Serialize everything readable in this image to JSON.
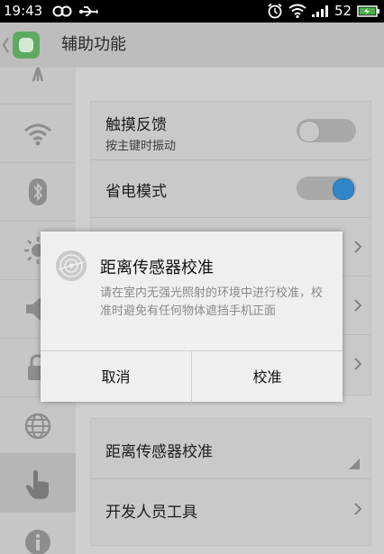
{
  "status_bar": {
    "time": "19:43",
    "battery": "52"
  },
  "header": {
    "title": "辅助功能"
  },
  "settings": {
    "touch_feedback": {
      "label": "触摸反馈",
      "sub": "按主键时振动",
      "state": "off"
    },
    "power_saving": {
      "label": "省电模式",
      "state": "on"
    },
    "proximity_calibration": {
      "label": "距离传感器校准"
    },
    "developer_tools": {
      "label": "开发人员工具"
    }
  },
  "dialog": {
    "title": "距离传感器校准",
    "message": "请在室内无强光照射的环境中进行校准，校准时避免有任何物体遮挡手机正面",
    "cancel": "取消",
    "confirm": "校准"
  },
  "sidebar": {
    "icons": [
      "antenna-icon",
      "wifi-icon",
      "bluetooth-icon",
      "brightness-icon",
      "volume-icon",
      "lock-icon",
      "globe-icon",
      "hand-touch-icon",
      "info-icon"
    ],
    "active": "hand-touch-icon"
  },
  "colors": {
    "toggle_on": "#2f86c8",
    "app_icon": "#5faa63"
  }
}
